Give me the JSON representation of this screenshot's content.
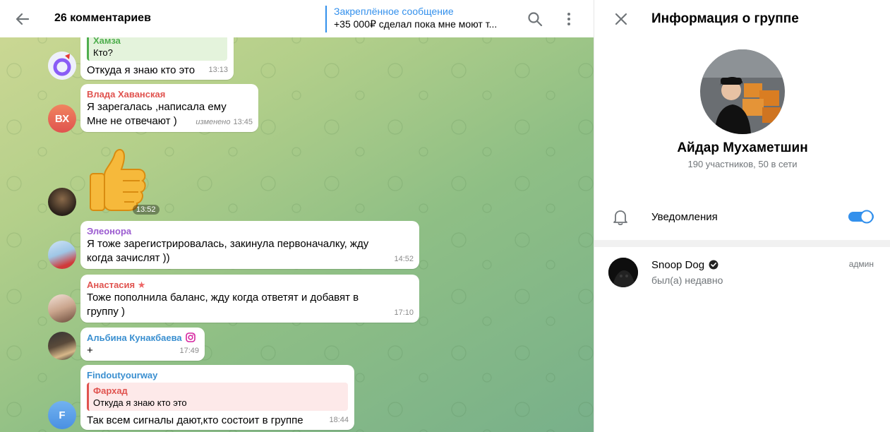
{
  "header": {
    "title": "26 комментариев",
    "pinned_label": "Закреплённое сообщение",
    "pinned_text": "+35 000₽ сделал пока мне моют т..."
  },
  "messages": [
    {
      "reply_author": "Хамза",
      "reply_text": "Кто?",
      "text": "Откуда я знаю кто это",
      "time": "13:13"
    },
    {
      "author": "Влада Хаванская",
      "author_color": "#e0534f",
      "avatar_initials": "ВХ",
      "line1": "Я зарегалась ,написала ему",
      "line2": "Мне не отвечают )",
      "edited": "изменено",
      "time": "13:45"
    },
    {
      "sticker": "thumbs-up",
      "time": "13:52"
    },
    {
      "author": "Элеонора",
      "author_color": "#9b5bd0",
      "line1": "Я тоже зарегистрировалась, закинула первоначалку, жду",
      "line2": "когда зачислят ))",
      "time": "14:52"
    },
    {
      "author": "Анастасия",
      "author_color": "#e0534f",
      "line1": "Тоже пополнила баланс, жду когда ответят и добавят в",
      "line2": "группу )",
      "time": "17:10"
    },
    {
      "author": "Альбина Кунакбаева",
      "author_color": "#3a8fd0",
      "text": "+",
      "time": "17:49"
    },
    {
      "author": "Findoutyourway",
      "author_color": "#3a8fd0",
      "avatar_initials": "F",
      "reply_author": "Фархад",
      "reply_text": "Откуда я знаю кто это",
      "text": "Так всем сигналы дают,кто состоит в группе",
      "time": "18:44"
    }
  ],
  "info": {
    "title": "Информация о группе",
    "group_name": "Айдар Мухаметшин",
    "stats": "190 участников, 50 в сети",
    "notifications_label": "Уведомления",
    "notifications_on": true,
    "member": {
      "name": "Snoop Dog",
      "status": "был(а) недавно",
      "role": "админ"
    }
  },
  "colors": {
    "accent": "#3390ec"
  }
}
